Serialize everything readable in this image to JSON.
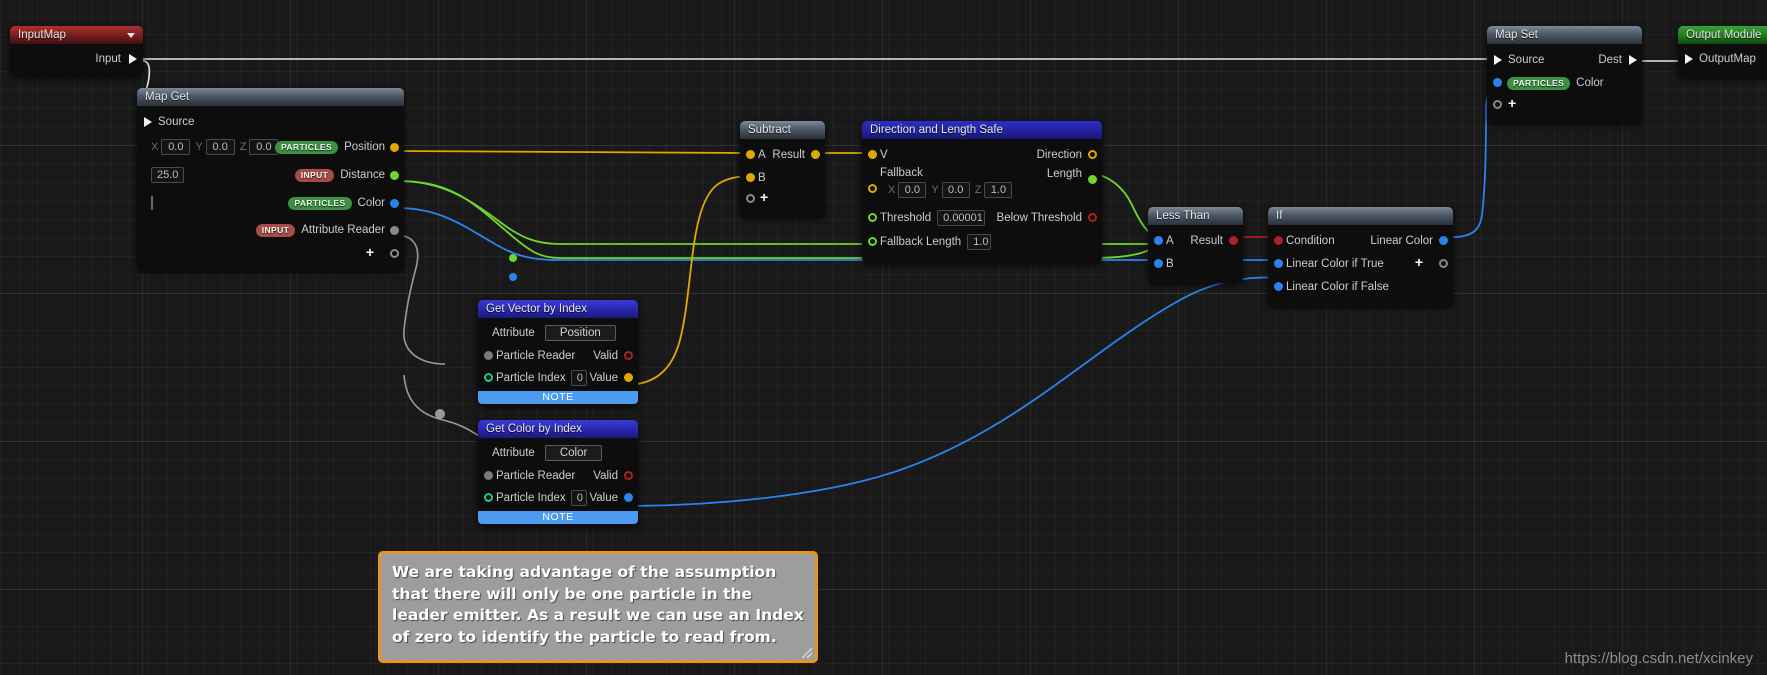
{
  "watermark": "https://blog.csdn.net/xcinkey",
  "comment": {
    "text": "We are taking advantage of the assumption that there will only be one particle in the leader emitter. As a result we can use an Index of zero to identify the particle to read from.",
    "border_color": "#e8951f",
    "fill_color": "#9d9d9d"
  },
  "nodes": {
    "input_map": {
      "title": "InputMap",
      "output_label": "Input"
    },
    "map_get": {
      "title": "Map Get",
      "source_label": "Source",
      "rows": [
        {
          "chip": "PARTICLES",
          "label": "Position",
          "x": "0.0",
          "y": "0.0",
          "z": "0.0"
        },
        {
          "chip": "INPUT",
          "label": "Distance",
          "value": "25.0"
        },
        {
          "chip": "PARTICLES",
          "label": "Color",
          "swatch": "#ffffff"
        },
        {
          "chip": "INPUT",
          "label": "Attribute Reader"
        }
      ],
      "add_label": "+"
    },
    "subtract": {
      "title": "Subtract",
      "inputs": [
        "A",
        "B"
      ],
      "output": "Result",
      "add_label": "+"
    },
    "dir_len_safe": {
      "title": "Direction and Length Safe",
      "input_v": "V",
      "fallback_label": "Fallback",
      "fallback_x": "0.0",
      "fallback_y": "0.0",
      "fallback_z": "1.0",
      "threshold_label": "Threshold",
      "threshold_value": "0.00001",
      "fallback_length_label": "Fallback Length",
      "fallback_length_value": "1.0",
      "out_direction": "Direction",
      "out_length": "Length",
      "out_below_threshold": "Below Threshold"
    },
    "less_than": {
      "title": "Less Than",
      "inputs": [
        "A",
        "B"
      ],
      "output": "Result"
    },
    "if_node": {
      "title": "If",
      "inputs": [
        "Condition",
        "Linear Color if True",
        "Linear Color if False"
      ],
      "output": "Linear Color",
      "add_label": "+"
    },
    "get_vector_by_index": {
      "title": "Get Vector by Index",
      "attribute_label": "Attribute",
      "attribute_value": "Position",
      "particle_reader_label": "Particle Reader",
      "particle_index_label": "Particle Index",
      "particle_index_value": "0",
      "valid_label": "Valid",
      "value_label": "Value",
      "note": "NOTE"
    },
    "get_color_by_index": {
      "title": "Get Color by Index",
      "attribute_label": "Attribute",
      "attribute_value": "Color",
      "particle_reader_label": "Particle Reader",
      "particle_index_label": "Particle Index",
      "particle_index_value": "0",
      "valid_label": "Valid",
      "value_label": "Value",
      "note": "NOTE"
    },
    "map_set": {
      "title": "Map Set",
      "source_label": "Source",
      "dest_label": "Dest",
      "chip": "PARTICLES",
      "color_label": "Color",
      "add_label": "+"
    },
    "output_module": {
      "title": "Output Module",
      "output_label": "OutputMap"
    }
  },
  "colors": {
    "wire_white": "#e8e8e8",
    "wire_yellow": "#e0a800",
    "wire_green": "#6fd62e",
    "wire_blue": "#2a84f0",
    "wire_red": "#b02020",
    "wire_grey": "#9a9a9a",
    "pin_vector": "#e0a800",
    "pin_float": "#6fd62e",
    "pin_color": "#2a84f0",
    "pin_bool": "#b02020",
    "pin_object": "#8a8a8a"
  }
}
